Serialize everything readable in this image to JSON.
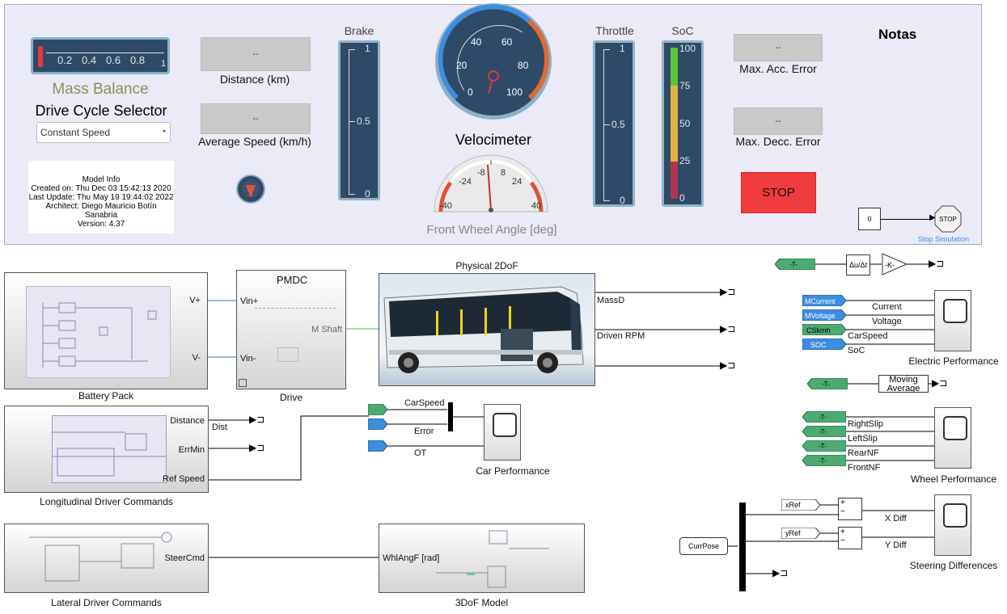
{
  "dashboard": {
    "mass_balance": {
      "label": "Mass Balance",
      "ticks": [
        "0.2",
        "0.4",
        "0.6",
        "0.8",
        "1"
      ]
    },
    "drive_cycle": {
      "label": "Drive Cycle Selector",
      "selected": "Constant Speed"
    },
    "model_info": {
      "title": "Model Info",
      "created": "Created on: Thu Dec 03 15:42:13 2020",
      "updated": "Last Update: Thu May 19 19:44:02 2022",
      "architect": "Architect: Diego Mauricio Botín Sanabria",
      "version": "Version: 4.37"
    },
    "distance": {
      "value": "--",
      "label": "Distance (km)"
    },
    "avg_speed": {
      "value": "--",
      "label": "Average Speed (km/h)"
    },
    "brake": {
      "label": "Brake",
      "ticks": [
        "1",
        "0.5",
        "0"
      ],
      "level": 0
    },
    "velocimeter": {
      "label": "Velocimeter",
      "ticks": [
        "0",
        "20",
        "40",
        "60",
        "80",
        "100"
      ],
      "value": 0
    },
    "front_wheel": {
      "label": "Front Wheel Angle [deg]",
      "ticks": [
        "-40",
        "-24",
        "-8",
        "8",
        "24",
        "40"
      ]
    },
    "throttle": {
      "label": "Throttle",
      "ticks": [
        "1",
        "0.5",
        "0"
      ],
      "level": 0
    },
    "soc": {
      "label": "SoC",
      "ticks": [
        "100",
        "75",
        "50",
        "25",
        "0"
      ]
    },
    "max_acc": {
      "value": "--",
      "label": "Max. Acc. Error"
    },
    "max_dec": {
      "value": "--",
      "label": "Max. Decc. Error"
    },
    "notas": "Notas",
    "stop_button": "STOP",
    "constant": "0",
    "stop_block": {
      "label": "STOP",
      "caption": "Stop Simulation"
    }
  },
  "blocks": {
    "battery": {
      "caption": "Battery Pack",
      "ports": [
        "V+",
        "V-"
      ]
    },
    "drive": {
      "title": "PMDC",
      "caption": "Drive",
      "ports": [
        "Vin+",
        "Vin-",
        "M Shaft"
      ]
    },
    "physical": {
      "title": "Physical 2DoF",
      "ports": [
        "MassD",
        "Driven RPM"
      ]
    },
    "longitudinal": {
      "caption": "Longitudinal Driver Commands",
      "ports": [
        "Distance",
        "ErrMin",
        "Ref Speed"
      ],
      "signal": "Dist"
    },
    "lateral": {
      "caption": "Lateral Driver Commands",
      "ports": [
        "SteerCmd"
      ]
    },
    "threedof": {
      "caption": "3DoF Model",
      "ports": [
        "WhlAngF [rad]"
      ]
    },
    "car_perf": {
      "caption": "Car Performance",
      "signals": [
        "CarSpeed",
        "Error",
        "OT"
      ]
    },
    "derivative": {
      "label": "Δu/Δt",
      "gain": "-K-"
    },
    "electric": {
      "caption": "Electric Performance",
      "tags": [
        "MCurrent",
        "MVoltage",
        "CSkmh",
        "SOC"
      ],
      "signals": [
        "Current",
        "Voltage",
        "CarSpeed",
        "SoC"
      ]
    },
    "moving_avg": {
      "label": "Moving Average"
    },
    "wheel": {
      "caption": "Wheel Performance",
      "signals": [
        "RightSlip",
        "LeftSlip",
        "RearNF",
        "FrontNF"
      ]
    },
    "steering": {
      "caption": "Steering Differences",
      "refs": [
        "xRef",
        "yRef"
      ],
      "signals": [
        "X Diff",
        "Y Diff"
      ],
      "source": "CurrPose"
    },
    "goto_tag": "-T-"
  },
  "colors": {
    "dashboard_bg": "#ebeaf7",
    "stop_red": "#f03c3c",
    "tag_green": "#4caa73",
    "tag_blue": "#3d8de0",
    "soc_green": "#5cc43a",
    "soc_yellow": "#e3b33e",
    "soc_red": "#b53350"
  }
}
